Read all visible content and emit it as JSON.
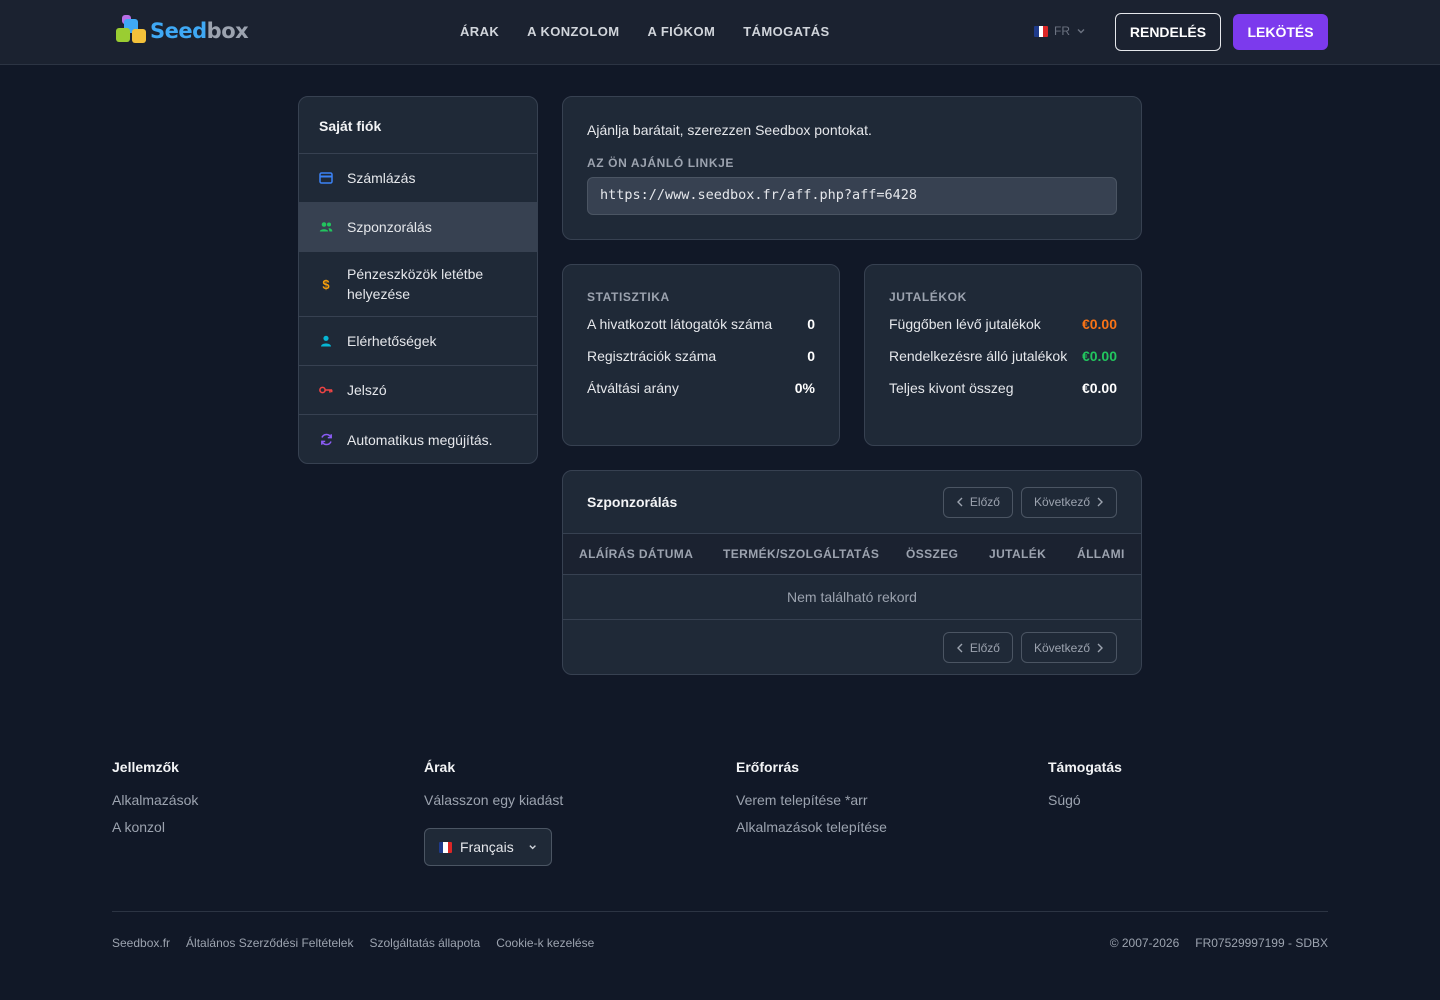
{
  "header": {
    "brand_seed": "Seed",
    "brand_box": "box",
    "nav": [
      "ÁRAK",
      "A KONZOLOM",
      "A FIÓKOM",
      "TÁMOGATÁS"
    ],
    "lang": "FR",
    "order_label": "RENDELÉS",
    "subscribe_label": "LEKÖTÉS"
  },
  "sidebar": {
    "title": "Saját fiók",
    "items": [
      {
        "label": "Számlázás",
        "icon": "credit-card-icon",
        "color": "#3b82f6"
      },
      {
        "label": "Szponzorálás",
        "icon": "users-icon",
        "color": "#22c55e",
        "active": true
      },
      {
        "label": "Pénzeszközök letétbe helyezése",
        "icon": "dollar-icon",
        "color": "#f59e0b"
      },
      {
        "label": "Elérhetőségek",
        "icon": "user-icon",
        "color": "#06b6d4"
      },
      {
        "label": "Jelszó",
        "icon": "key-icon",
        "color": "#ef4444"
      },
      {
        "label": "Automatikus megújítás.",
        "icon": "refresh-icon",
        "color": "#8b5cf6"
      }
    ]
  },
  "referral": {
    "intro": "Ajánlja barátait, szerezzen Seedbox pontokat.",
    "link_label": "AZ ÖN AJÁNLÓ LINKJE",
    "link_value": "https://www.seedbox.fr/aff.php?aff=6428"
  },
  "stats": {
    "title": "STATISZTIKA",
    "rows": [
      {
        "label": "A hivatkozott látogatók száma",
        "value": "0"
      },
      {
        "label": "Regisztrációk száma",
        "value": "0"
      },
      {
        "label": "Átváltási arány",
        "value": "0%"
      }
    ]
  },
  "rewards": {
    "title": "JUTALÉKOK",
    "rows": [
      {
        "label": "Függőben lévő jutalékok",
        "value": "€0.00",
        "color": "#f97316"
      },
      {
        "label": "Rendelkezésre álló jutalékok",
        "value": "€0.00",
        "color": "#22c55e"
      },
      {
        "label": "Teljes kivont összeg",
        "value": "€0.00",
        "color": "#ffffff"
      }
    ]
  },
  "table": {
    "title": "Szponzorálás",
    "prev": "Előző",
    "next": "Következő",
    "columns": [
      "ALÁÍRÁS DÁTUMA",
      "TERMÉK/SZOLGÁLTATÁS",
      "ÖSSZEG",
      "JUTALÉK",
      "ÁLLAMI"
    ],
    "empty": "Nem található rekord"
  },
  "footer": {
    "cols": [
      {
        "title": "Jellemzők",
        "links": [
          "Alkalmazások",
          "A konzol"
        ]
      },
      {
        "title": "Árak",
        "links": [
          "Válasszon egy kiadást"
        ]
      },
      {
        "title": "Erőforrás",
        "links": [
          "Verem telepítése *arr",
          "Alkalmazások telepítése"
        ]
      },
      {
        "title": "Támogatás",
        "links": [
          "Súgó"
        ]
      }
    ],
    "lang_select": "Français",
    "legal": [
      "Seedbox.fr",
      "Általános Szerződési Feltételek",
      "Szolgáltatás állapota",
      "Cookie-k kezelése"
    ],
    "copyright": "© 2007-2026",
    "company": "FR07529997199 - SDBX"
  },
  "colors": {
    "accent": "#7c3aed",
    "background": "#111827",
    "card": "#1f2937"
  }
}
